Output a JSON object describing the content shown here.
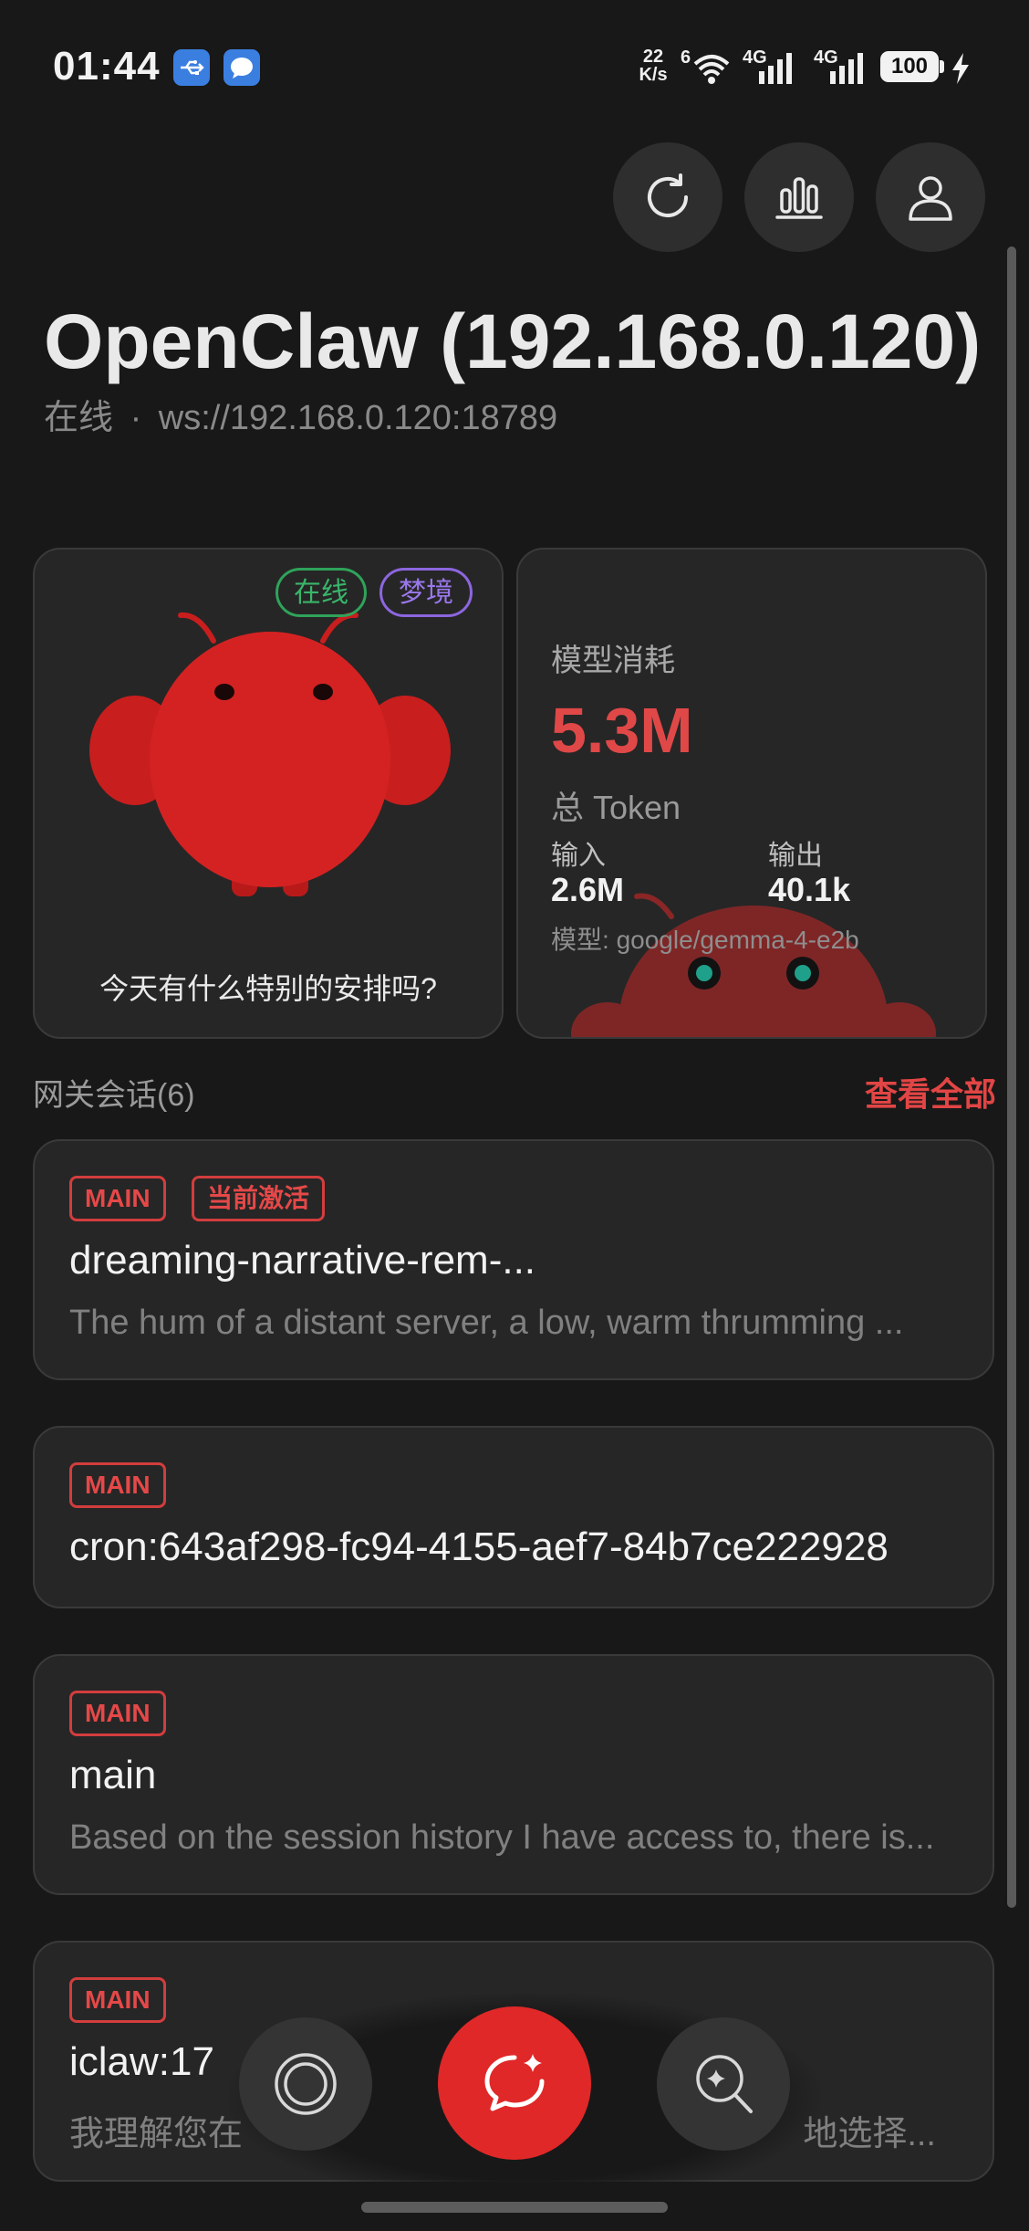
{
  "status_bar": {
    "time": "01:44",
    "net_speed_value": "22",
    "net_speed_unit": "K/s",
    "wifi_label": "6",
    "sim1_label": "4G",
    "sim2_label": "4G",
    "battery": "100",
    "icons": [
      "usb-icon",
      "message-icon",
      "wifi-icon",
      "signal-icon",
      "battery-icon",
      "charging-icon"
    ]
  },
  "header": {
    "buttons": [
      "refresh-icon",
      "stats-icon",
      "profile-icon"
    ],
    "title": "OpenClaw (192.168.0.120)",
    "status": "在线",
    "separator": "·",
    "address": "ws://192.168.0.120:18789"
  },
  "pet_card": {
    "badge_online": "在线",
    "badge_dream": "梦境",
    "caption": "今天有什么特别的安排吗?"
  },
  "token_card": {
    "label": "模型消耗",
    "total_value": "5.3M",
    "total_unit": "总 Token",
    "input_label": "输入",
    "input_value": "2.6M",
    "output_label": "输出",
    "output_value": "40.1k",
    "model_prefix": "模型:",
    "model_name": "google/gemma-4-e2b"
  },
  "sessions_section": {
    "title": "网关会话(6)",
    "view_all": "查看全部"
  },
  "sessions": [
    {
      "tag": "MAIN",
      "tag2": "当前激活",
      "title": "dreaming-narrative-rem-...",
      "desc": "The hum of a distant server, a low, warm thrumming ..."
    },
    {
      "tag": "MAIN",
      "title": "cron:643af298-fc94-4155-aef7-84b7ce222928"
    },
    {
      "tag": "MAIN",
      "title": "main",
      "desc": "Based on the session history I have access to, there is..."
    },
    {
      "tag": "MAIN",
      "title_visible": "iclaw:17",
      "desc_visible_start": "我理解您在",
      "desc_visible_end": "地选择..."
    }
  ],
  "bottom_nav": {
    "left": "lens-icon",
    "center": "chat-sparkle-icon",
    "right": "ai-search-icon"
  },
  "colors": {
    "background": "#181818",
    "card": "#262626",
    "accent_red": "#e02828",
    "online_green": "#2fa35a",
    "dream_purple": "#8d66df"
  }
}
